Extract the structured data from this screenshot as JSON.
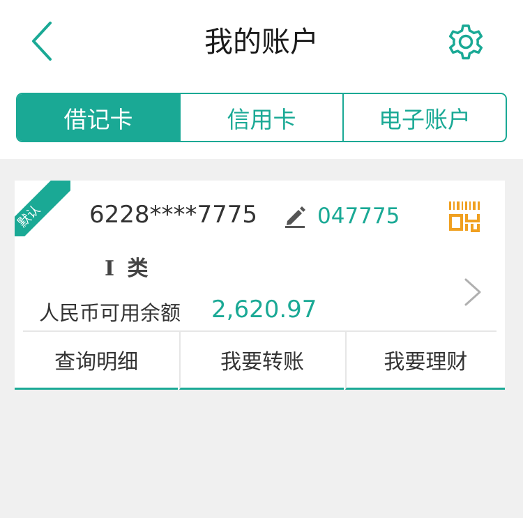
{
  "header": {
    "title": "我的账户",
    "back_icon": "chevron-left-icon",
    "settings_icon": "gear-icon"
  },
  "tabs": [
    {
      "label": "借记卡",
      "active": true
    },
    {
      "label": "信用卡",
      "active": false
    },
    {
      "label": "电子账户",
      "active": false
    }
  ],
  "card": {
    "default_badge": "默认",
    "masked_number": "6228****7775",
    "short_number": "047775",
    "class_label": "I 类",
    "balance_label": "人民币可用余额",
    "balance_value": "2,620.97",
    "edit_icon": "pencil-icon",
    "qr_icon": "qr-code-icon",
    "arrow_icon": "chevron-right-icon"
  },
  "actions": [
    {
      "label": "查询明细"
    },
    {
      "label": "我要转账"
    },
    {
      "label": "我要理财"
    }
  ],
  "colors": {
    "accent": "#1aa995",
    "qr_orange": "#f0a020",
    "background": "#f0f0f0"
  }
}
